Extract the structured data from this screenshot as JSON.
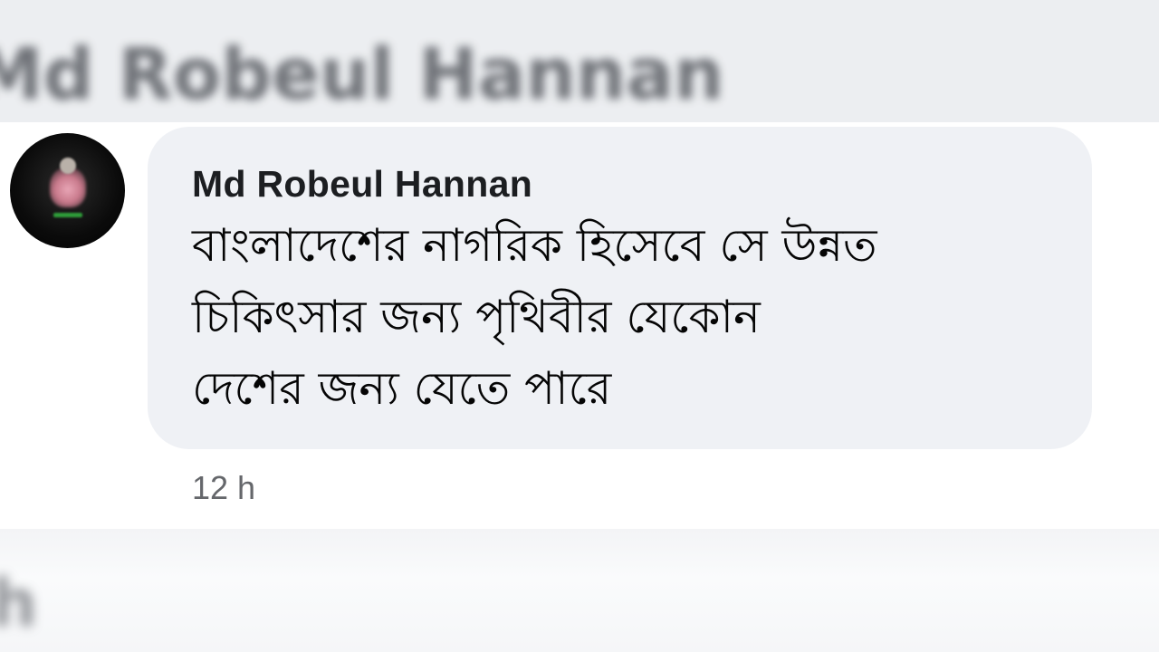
{
  "background": {
    "top_blurred_name": "Md Robeul Hannan",
    "bottom_blurred_text": "h"
  },
  "comment": {
    "author": "Md Robeul Hannan",
    "message_lines": [
      "বাংলাদেশের নাগরিক হিসেবে সে উন্নত",
      "চিকিৎসার জন্য পৃথিবীর যেকোন",
      "দেশের জন্য যেতে পারে"
    ],
    "time": "12 h"
  },
  "colors": {
    "bubble": "#eff1f5",
    "author_text": "#1c1e21",
    "message_text": "#050505",
    "time_text": "#65676b"
  }
}
